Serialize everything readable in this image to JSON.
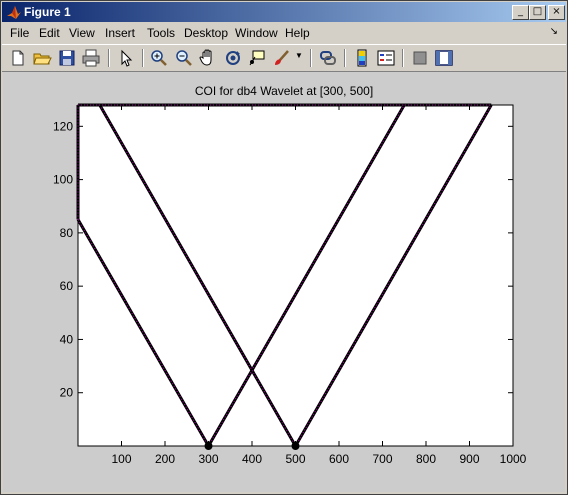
{
  "window": {
    "title": "Figure 1",
    "controls": {
      "minimize": "_",
      "maximize": "□",
      "close": "×"
    }
  },
  "menu": {
    "items": [
      "File",
      "Edit",
      "View",
      "Insert",
      "Tools",
      "Desktop",
      "Window",
      "Help"
    ],
    "overflow_arrow": "↘"
  },
  "toolbar": {
    "icons": [
      "new-figure-icon",
      "open-file-icon",
      "save-icon",
      "print-icon",
      "edit-plot-arrow-icon",
      "zoom-in-icon",
      "zoom-out-icon",
      "pan-hand-icon",
      "rotate-3d-icon",
      "data-cursor-icon",
      "brush-icon",
      "link-plot-icon",
      "colorbar-icon",
      "legend-icon",
      "hide-plot-tools-icon",
      "show-plot-tools-icon"
    ]
  },
  "chart_data": {
    "type": "line",
    "title": "COI for db4 Wavelet at [300, 500]",
    "xlabel": "",
    "ylabel": "",
    "xlim": [
      0,
      1000
    ],
    "ylim": [
      0,
      128
    ],
    "x_ticks": [
      "100",
      "200",
      "300",
      "400",
      "500",
      "600",
      "700",
      "800",
      "900",
      "1000"
    ],
    "y_ticks": [
      "20",
      "40",
      "60",
      "80",
      "100",
      "120"
    ],
    "grid": false,
    "colors": {
      "line": "#000000",
      "dotted_overlay": "#b000b0"
    },
    "series": [
      {
        "points": [
          [
            0,
            85
          ],
          [
            300,
            0
          ]
        ]
      },
      {
        "points": [
          [
            300,
            0
          ],
          [
            750,
            128
          ]
        ]
      },
      {
        "points": [
          [
            50,
            128
          ],
          [
            500,
            0
          ]
        ]
      },
      {
        "points": [
          [
            500,
            0
          ],
          [
            950,
            128
          ]
        ]
      },
      {
        "points": [
          [
            0,
            128
          ],
          [
            950,
            128
          ]
        ]
      },
      {
        "points": [
          [
            0,
            85
          ],
          [
            0,
            128
          ]
        ]
      }
    ],
    "markers": [
      [
        300,
        0
      ],
      [
        500,
        0
      ]
    ]
  }
}
